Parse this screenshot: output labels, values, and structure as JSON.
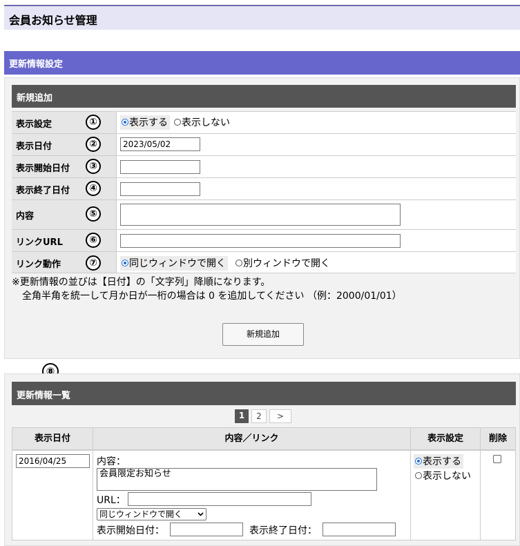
{
  "page_title": "会員お知らせ管理",
  "section_title": "更新情報設定",
  "add_section": {
    "title": "新規追加",
    "rows": {
      "display": {
        "label": "表示設定",
        "marker": "①",
        "options": [
          "表示する",
          "表示しない"
        ],
        "selected": 0
      },
      "date": {
        "label": "表示日付",
        "marker": "②",
        "value": "2023/05/02"
      },
      "start": {
        "label": "表示開始日付",
        "marker": "③",
        "value": ""
      },
      "end": {
        "label": "表示終了日付",
        "marker": "④",
        "value": ""
      },
      "content": {
        "label": "内容",
        "marker": "⑤",
        "value": ""
      },
      "link": {
        "label": "リンクURL",
        "marker": "⑥",
        "value": ""
      },
      "link_action": {
        "label": "リンク動作",
        "marker": "⑦",
        "options": [
          "同じウィンドウで開く",
          "別ウィンドウで開く"
        ],
        "selected": 0
      }
    },
    "note_line1": "※更新情報の並びは【日付】の「文字列」降順になります。",
    "note_line2": "全角半角を統一して月か日が一桁の場合は 0 を追加してください （例：2000/01/01）",
    "add_button": "新規追加"
  },
  "list_marker": "⑧",
  "list_section": {
    "title": "更新情報一覧",
    "pagination": {
      "pages": [
        "1",
        "2"
      ],
      "current": "1",
      "next": ">"
    },
    "columns": [
      "表示日付",
      "内容／リンク",
      "表示設定",
      "削除"
    ],
    "rows": [
      {
        "date": "2016/04/25",
        "content_label": "内容：",
        "content": "会員限定お知らせ",
        "url_label": "URL：",
        "url": "",
        "window_select": "同じウィンドウで開く",
        "start_label": "表示開始日付：",
        "start": "",
        "end_label": "表示終了日付：",
        "end": "",
        "display_options": [
          "表示する",
          "表示しない"
        ],
        "display_selected": 0,
        "delete_checked": false
      }
    ]
  }
}
